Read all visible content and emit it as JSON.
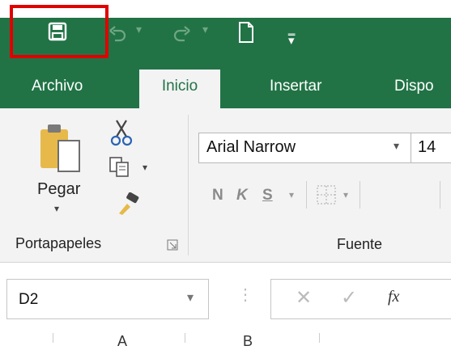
{
  "tabs": [
    "Archivo",
    "Inicio",
    "Insertar",
    "Dispo"
  ],
  "clipboard": {
    "paste_label": "Pegar",
    "group_label": "Portapapeles"
  },
  "font": {
    "name": "Arial Narrow",
    "size": "14",
    "group_label": "Fuente",
    "bold": "N",
    "italic": "K",
    "underline": "S"
  },
  "namebox": {
    "value": "D2"
  },
  "formula": {
    "fx": "fx"
  },
  "columns": [
    "A",
    "B"
  ],
  "colors": {
    "excel_green": "#217346",
    "highlight_box": "#e00000"
  }
}
